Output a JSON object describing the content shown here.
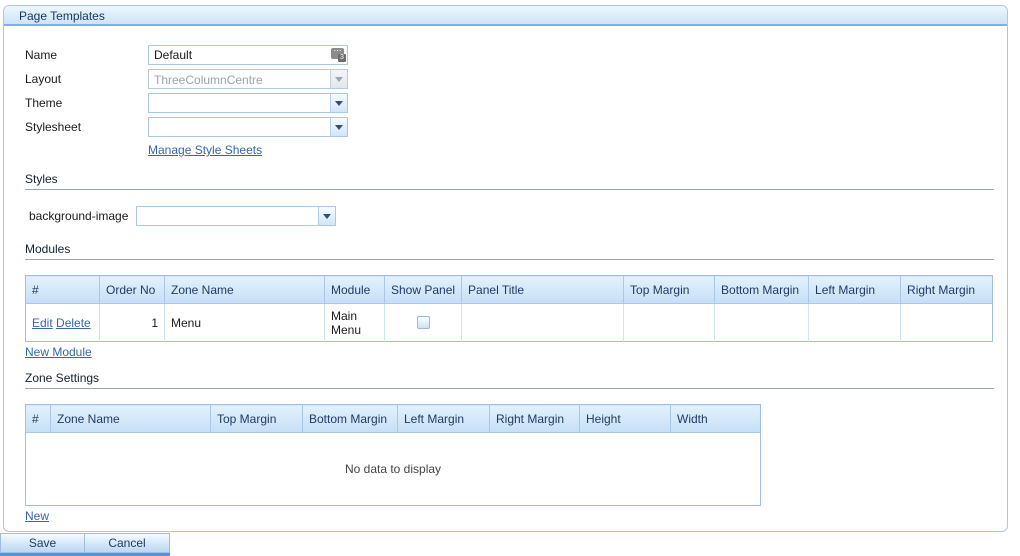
{
  "panel": {
    "title": "Page Templates"
  },
  "form": {
    "name_label": "Name",
    "name_value": "Default",
    "layout_label": "Layout",
    "layout_value": "ThreeColumnCentre",
    "theme_label": "Theme",
    "theme_value": "",
    "stylesheet_label": "Stylesheet",
    "stylesheet_value": "",
    "manage_stylesheets_link": "Manage Style Sheets"
  },
  "styles": {
    "heading": "Styles",
    "background_image_label": "background-image",
    "background_image_value": ""
  },
  "modules": {
    "heading": "Modules",
    "columns": [
      "#",
      "Order No",
      "Zone Name",
      "Module",
      "Show Panel",
      "Panel Title",
      "Top Margin",
      "Bottom Margin",
      "Left Margin",
      "Right Margin"
    ],
    "rows": [
      {
        "edit_link": "Edit",
        "delete_link": "Delete",
        "order_no": "1",
        "zone_name": "Menu",
        "module": "Main Menu",
        "show_panel_checked": false,
        "panel_title": "",
        "top_margin": "",
        "bottom_margin": "",
        "left_margin": "",
        "right_margin": ""
      }
    ],
    "new_module_link": "New Module"
  },
  "zone_settings": {
    "heading": "Zone Settings",
    "columns": [
      "#",
      "Zone Name",
      "Top Margin",
      "Bottom Margin",
      "Left Margin",
      "Right Margin",
      "Height",
      "Width"
    ],
    "empty_text": "No data to display",
    "new_link": "New"
  },
  "footer": {
    "save_label": "Save",
    "cancel_label": "Cancel"
  },
  "colors": {
    "panel_border": "#a9c7e7",
    "header_underline": "#86ade0",
    "link": "#3565ad",
    "table_header_text": "#1e3c60",
    "footer_accent": "#5b92d4"
  }
}
